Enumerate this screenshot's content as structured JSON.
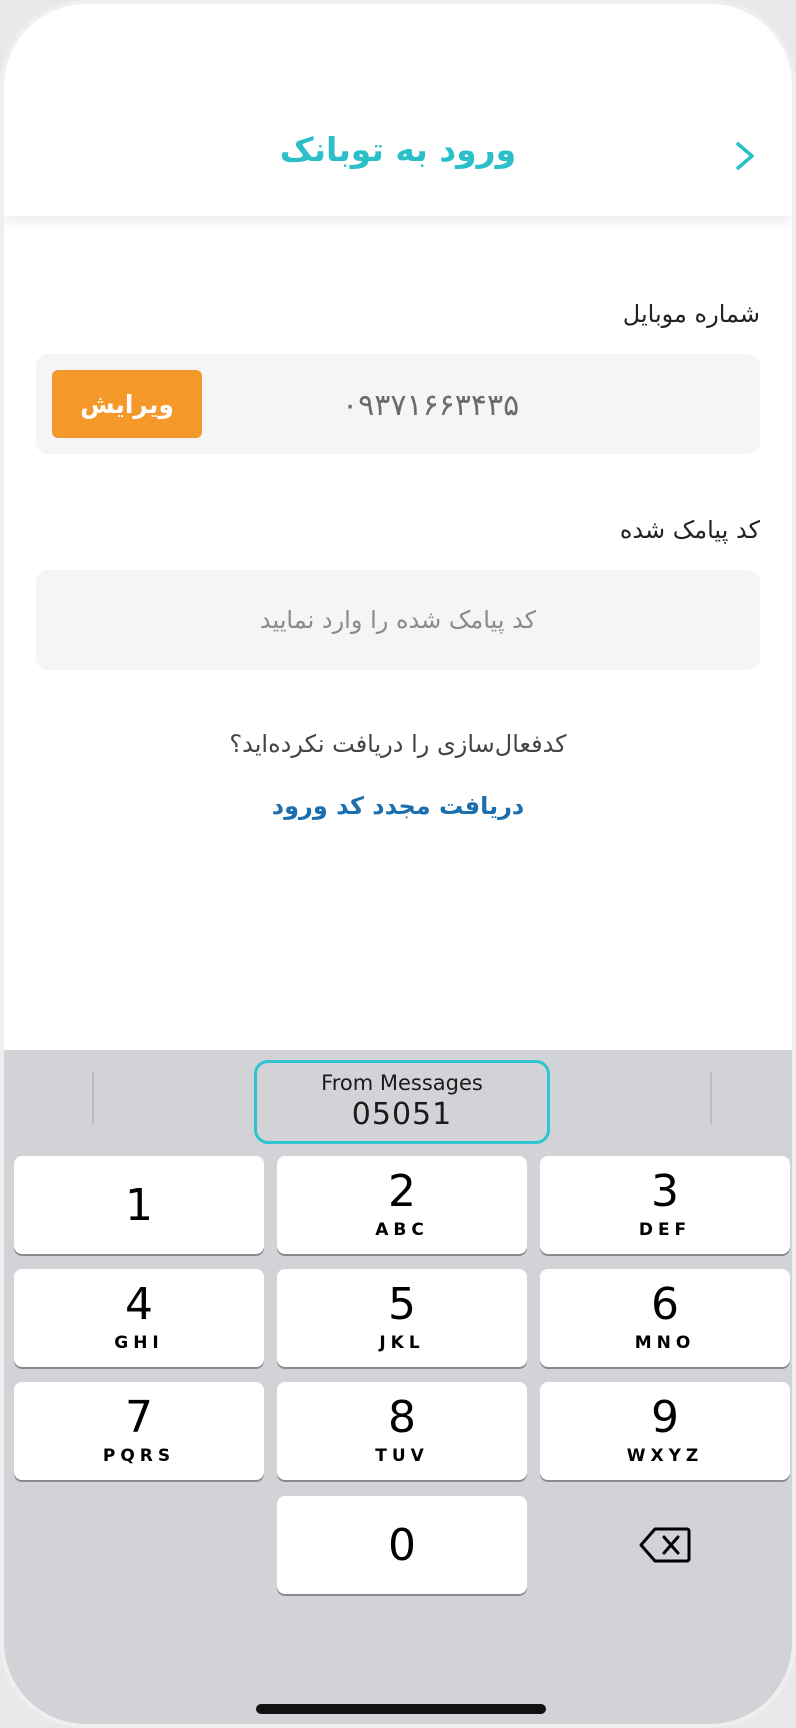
{
  "header": {
    "title": "ورود به توبانک",
    "back_icon": "chevron-right-icon",
    "accent_color": "#2bbfc9"
  },
  "form": {
    "mobile_label": "شماره موبایل",
    "mobile_value": "۰۹۳۷۱۶۶۳۴۳۵",
    "edit_button_label": "ویرایش",
    "edit_button_color": "#f4982a",
    "code_label": "کد پیامک شده",
    "code_placeholder": "کد پیامک شده را وارد نمایید",
    "code_value": ""
  },
  "help": {
    "not_received_text": "کدفعال‌سازی را دریافت نکرده‌اید؟",
    "resend_link_label": "دریافت مجدد کد ورود",
    "link_color": "#1b6fae"
  },
  "keyboard": {
    "suggestion": {
      "source_label": "From Messages",
      "code": "05051"
    },
    "keys": [
      {
        "num": "1",
        "letters": ""
      },
      {
        "num": "2",
        "letters": "ABC"
      },
      {
        "num": "3",
        "letters": "DEF"
      },
      {
        "num": "4",
        "letters": "GHI"
      },
      {
        "num": "5",
        "letters": "JKL"
      },
      {
        "num": "6",
        "letters": "MNO"
      },
      {
        "num": "7",
        "letters": "PQRS"
      },
      {
        "num": "8",
        "letters": "TUV"
      },
      {
        "num": "9",
        "letters": "WXYZ"
      },
      {
        "num": "0",
        "letters": ""
      }
    ],
    "delete_icon": "backspace-icon"
  }
}
